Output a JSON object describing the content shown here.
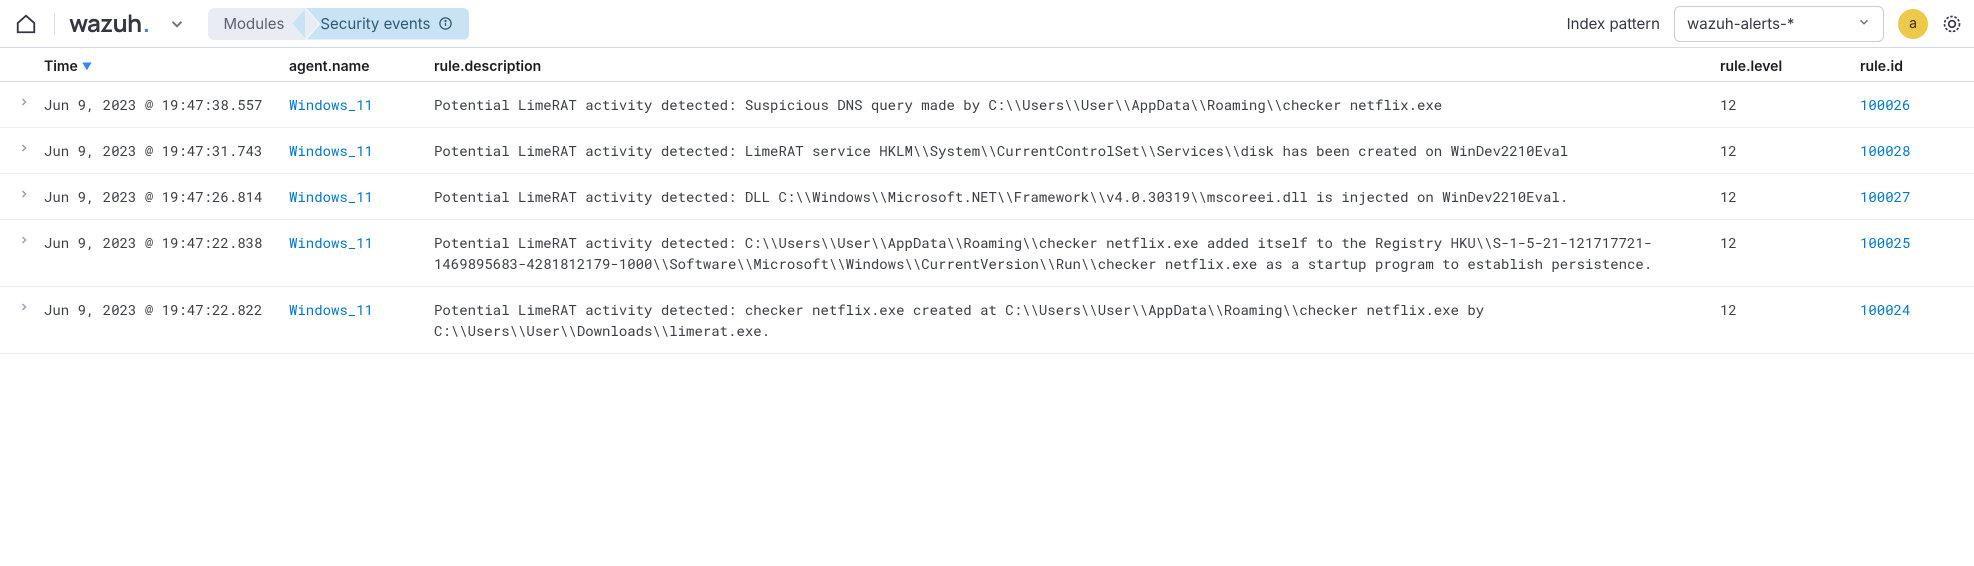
{
  "header": {
    "logo_text": "wazuh",
    "breadcrumbs": [
      {
        "label": "Modules"
      },
      {
        "label": "Security events",
        "has_info": true
      }
    ],
    "index_pattern_label": "Index pattern",
    "index_pattern_value": "wazuh-alerts-*",
    "avatar_letter": "a"
  },
  "columns": {
    "time": "Time",
    "agent": "agent.name",
    "description": "rule.description",
    "level": "rule.level",
    "id": "rule.id"
  },
  "rows": [
    {
      "time": "Jun 9, 2023 @ 19:47:38.557",
      "agent": "Windows_11",
      "description": "Potential LimeRAT activity detected: Suspicious DNS query made by C:\\\\Users\\\\User\\\\AppData\\\\Roaming\\\\checker netflix.exe",
      "level": "12",
      "id": "100026"
    },
    {
      "time": "Jun 9, 2023 @ 19:47:31.743",
      "agent": "Windows_11",
      "description": "Potential LimeRAT activity detected: LimeRAT service HKLM\\\\System\\\\CurrentControlSet\\\\Services\\\\disk has been created on WinDev2210Eval",
      "level": "12",
      "id": "100028"
    },
    {
      "time": "Jun 9, 2023 @ 19:47:26.814",
      "agent": "Windows_11",
      "description": "Potential LimeRAT activity detected: DLL C:\\\\Windows\\\\Microsoft.NET\\\\Framework\\\\v4.0.30319\\\\mscoreei.dll is injected on WinDev2210Eval.",
      "level": "12",
      "id": "100027"
    },
    {
      "time": "Jun 9, 2023 @ 19:47:22.838",
      "agent": "Windows_11",
      "description": "Potential LimeRAT activity detected:  C:\\\\Users\\\\User\\\\AppData\\\\Roaming\\\\checker netflix.exe added itself to the Registry HKU\\\\S-1-5-21-121717721-1469895683-4281812179-1000\\\\Software\\\\Microsoft\\\\Windows\\\\CurrentVersion\\\\Run\\\\checker netflix.exe as a startup program to establish persistence.",
      "level": "12",
      "id": "100025"
    },
    {
      "time": "Jun 9, 2023 @ 19:47:22.822",
      "agent": "Windows_11",
      "description": "Potential LimeRAT activity detected: checker netflix.exe created at C:\\\\Users\\\\User\\\\AppData\\\\Roaming\\\\checker netflix.exe by C:\\\\Users\\\\User\\\\Downloads\\\\limerat.exe.",
      "level": "12",
      "id": "100024"
    }
  ]
}
